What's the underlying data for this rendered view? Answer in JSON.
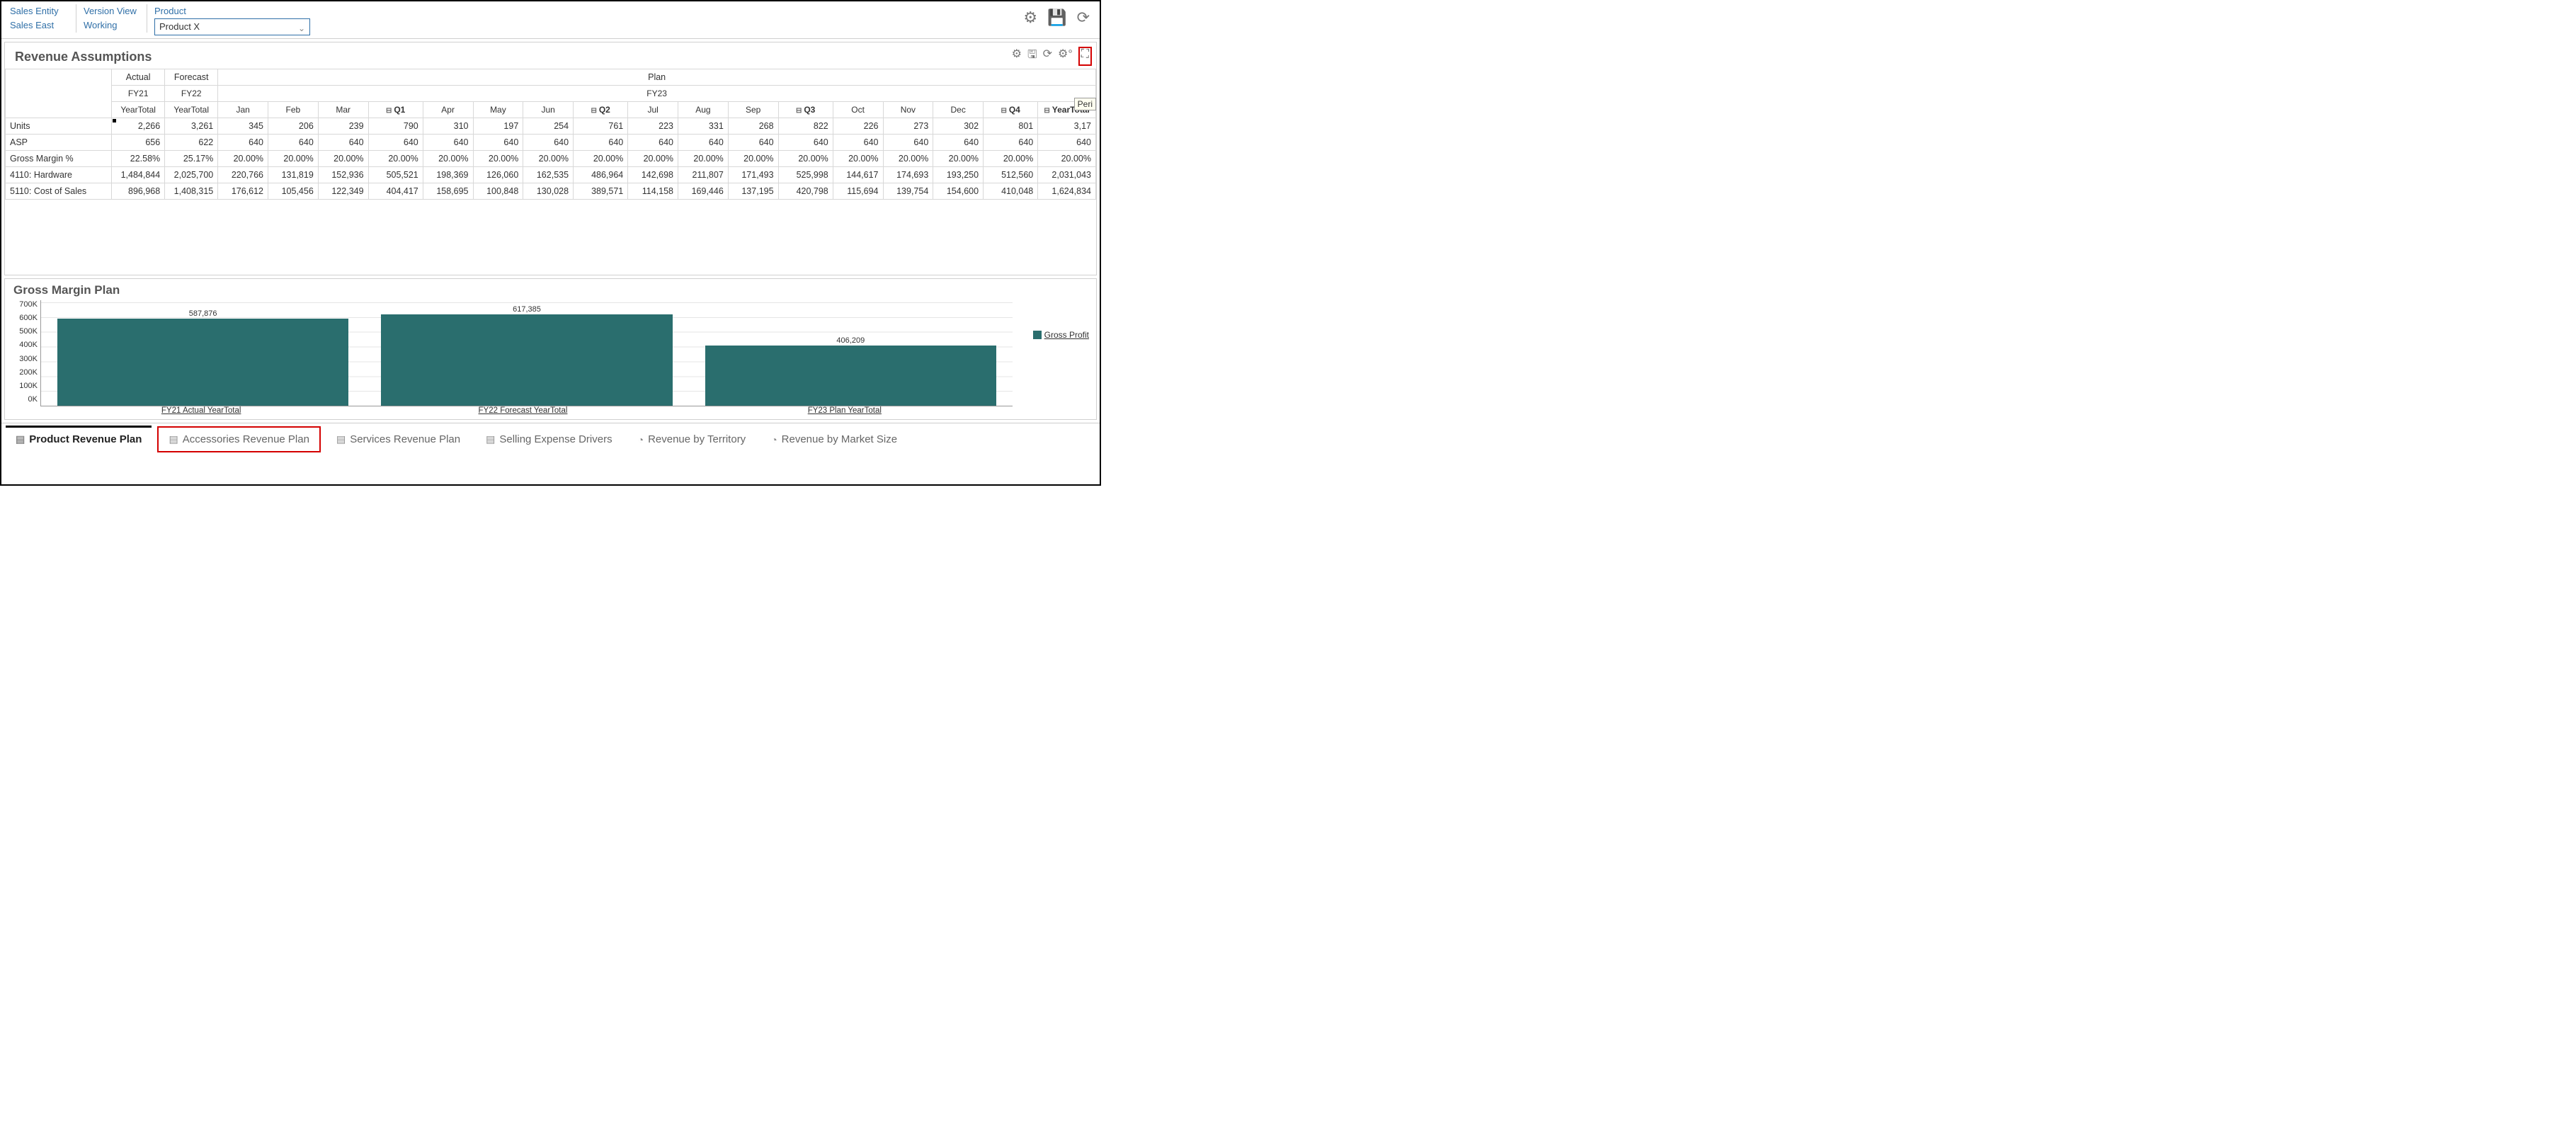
{
  "pov": {
    "entity_label": "Sales Entity",
    "entity_value": "Sales East",
    "version_label": "Version View",
    "version_value": "Working",
    "product_label": "Product",
    "product_value": "Product X"
  },
  "section1": {
    "title": "Revenue Assumptions",
    "tooltip": "Peri",
    "col_groups": {
      "g1": "Actual",
      "g1_sub": "FY21",
      "g1_sub2": "YearTotal",
      "g2": "Forecast",
      "g2_sub": "FY22",
      "g2_sub2": "YearTotal",
      "g3": "Plan",
      "g3_sub": "FY23"
    },
    "cols": [
      "Jan",
      "Feb",
      "Mar",
      "Q1",
      "Apr",
      "May",
      "Jun",
      "Q2",
      "Jul",
      "Aug",
      "Sep",
      "Q3",
      "Oct",
      "Nov",
      "Dec",
      "Q4",
      "YearTotal"
    ],
    "rows": [
      {
        "label": "Units",
        "vals": [
          "2,266",
          "3,261",
          "345",
          "206",
          "239",
          "790",
          "310",
          "197",
          "254",
          "761",
          "223",
          "331",
          "268",
          "822",
          "226",
          "273",
          "302",
          "801",
          "3,17"
        ]
      },
      {
        "label": "ASP",
        "vals": [
          "656",
          "622",
          "640",
          "640",
          "640",
          "640",
          "640",
          "640",
          "640",
          "640",
          "640",
          "640",
          "640",
          "640",
          "640",
          "640",
          "640",
          "640",
          "640"
        ]
      },
      {
        "label": "Gross Margin %",
        "vals": [
          "22.58%",
          "25.17%",
          "20.00%",
          "20.00%",
          "20.00%",
          "20.00%",
          "20.00%",
          "20.00%",
          "20.00%",
          "20.00%",
          "20.00%",
          "20.00%",
          "20.00%",
          "20.00%",
          "20.00%",
          "20.00%",
          "20.00%",
          "20.00%",
          "20.00%"
        ]
      },
      {
        "label": "4110: Hardware",
        "vals": [
          "1,484,844",
          "2,025,700",
          "220,766",
          "131,819",
          "152,936",
          "505,521",
          "198,369",
          "126,060",
          "162,535",
          "486,964",
          "142,698",
          "211,807",
          "171,493",
          "525,998",
          "144,617",
          "174,693",
          "193,250",
          "512,560",
          "2,031,043"
        ]
      },
      {
        "label": "5110: Cost of Sales",
        "vals": [
          "896,968",
          "1,408,315",
          "176,612",
          "105,456",
          "122,349",
          "404,417",
          "158,695",
          "100,848",
          "130,028",
          "389,571",
          "114,158",
          "169,446",
          "137,195",
          "420,798",
          "115,694",
          "139,754",
          "154,600",
          "410,048",
          "1,624,834"
        ]
      }
    ]
  },
  "section2": {
    "title": "Gross Margin Plan"
  },
  "chart_data": {
    "type": "bar",
    "title": "Gross Margin Plan",
    "categories": [
      "FY21 Actual YearTotal",
      "FY22 Forecast YearTotal",
      "FY23 Plan YearTotal"
    ],
    "series": [
      {
        "name": "Gross Profit",
        "values": [
          587876,
          617385,
          406209
        ]
      }
    ],
    "ylim": [
      0,
      700000
    ],
    "yticks": [
      "700K",
      "600K",
      "500K",
      "400K",
      "300K",
      "200K",
      "100K",
      "0K"
    ],
    "value_labels": [
      "587,876",
      "617,385",
      "406,209"
    ],
    "legend": "Gross Profit"
  },
  "tabs": [
    {
      "label": "Product Revenue Plan",
      "active": true,
      "highlight": false
    },
    {
      "label": "Accessories Revenue Plan",
      "active": false,
      "highlight": true
    },
    {
      "label": "Services Revenue Plan",
      "active": false,
      "highlight": false
    },
    {
      "label": "Selling Expense Drivers",
      "active": false,
      "highlight": false
    },
    {
      "label": "Revenue by Territory",
      "active": false,
      "highlight": false
    },
    {
      "label": "Revenue by Market Size",
      "active": false,
      "highlight": false
    }
  ]
}
